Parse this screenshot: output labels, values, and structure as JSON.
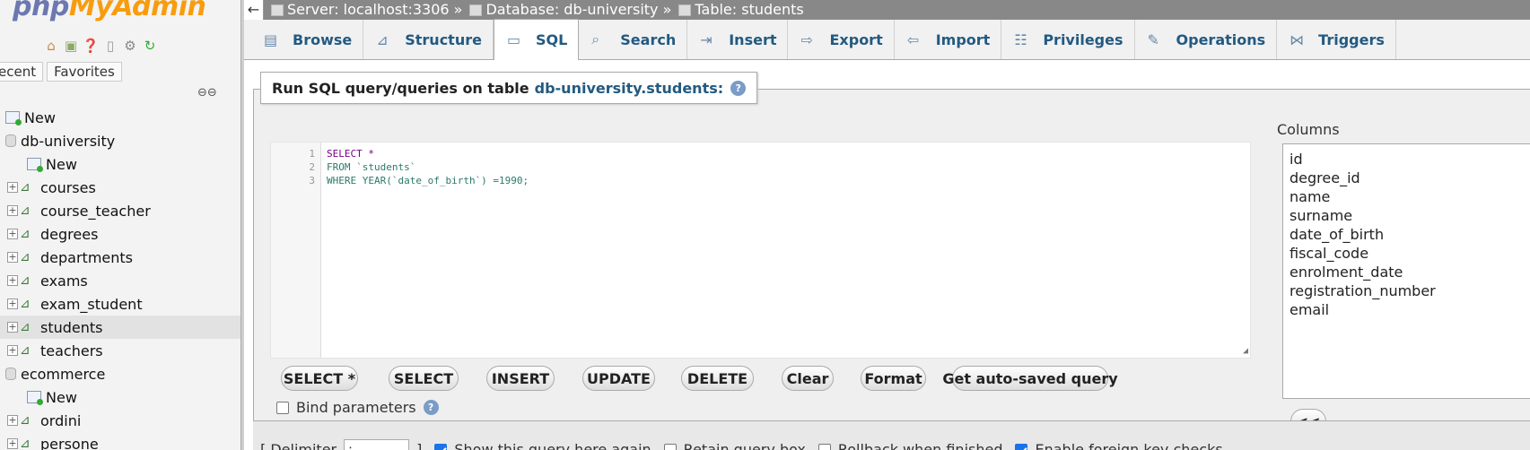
{
  "nav": {
    "logo_php": "php",
    "logo_myadmin": "MyAdmin",
    "tabs": [
      "ecent",
      "Favorites"
    ],
    "tree": [
      {
        "label": "New",
        "icon": "new-icon",
        "level": 0
      },
      {
        "label": "db-university",
        "icon": "database-icon",
        "level": 0
      },
      {
        "label": "New",
        "icon": "new-icon",
        "level": 1
      },
      {
        "label": "courses",
        "icon": "table-icon",
        "level": 1
      },
      {
        "label": "course_teacher",
        "icon": "table-icon",
        "level": 1
      },
      {
        "label": "degrees",
        "icon": "table-icon",
        "level": 1
      },
      {
        "label": "departments",
        "icon": "table-icon",
        "level": 1
      },
      {
        "label": "exams",
        "icon": "table-icon",
        "level": 1
      },
      {
        "label": "exam_student",
        "icon": "table-icon",
        "level": 1
      },
      {
        "label": "students",
        "icon": "table-icon",
        "level": 1,
        "selected": true
      },
      {
        "label": "teachers",
        "icon": "table-icon",
        "level": 1
      },
      {
        "label": "ecommerce",
        "icon": "database-icon",
        "level": 0
      },
      {
        "label": "New",
        "icon": "new-icon",
        "level": 1
      },
      {
        "label": "ordini",
        "icon": "table-icon",
        "level": 1
      },
      {
        "label": "persone",
        "icon": "table-icon",
        "level": 1
      }
    ]
  },
  "breadcrumb": {
    "server": "Server: localhost:3306 »",
    "database": "Database: db-university »",
    "table": "Table: students"
  },
  "tabs": [
    {
      "label": "Browse",
      "icon": "browse-icon"
    },
    {
      "label": "Structure",
      "icon": "structure-icon"
    },
    {
      "label": "SQL",
      "icon": "sql-icon",
      "active": true
    },
    {
      "label": "Search",
      "icon": "search-icon"
    },
    {
      "label": "Insert",
      "icon": "insert-icon"
    },
    {
      "label": "Export",
      "icon": "export-icon"
    },
    {
      "label": "Import",
      "icon": "import-icon"
    },
    {
      "label": "Privileges",
      "icon": "privileges-icon"
    },
    {
      "label": "Operations",
      "icon": "operations-icon"
    },
    {
      "label": "Triggers",
      "icon": "triggers-icon"
    }
  ],
  "sql_panel": {
    "legend_prefix": "Run SQL query/queries on table",
    "legend_table": "db-university.students:",
    "code_lines": [
      {
        "n": "1",
        "text": "SELECT *"
      },
      {
        "n": "2",
        "text": "FROM `students`"
      },
      {
        "n": "3",
        "text": "WHERE YEAR(`date_of_birth`) =1990;"
      }
    ],
    "buttons": [
      "SELECT *",
      "SELECT",
      "INSERT",
      "UPDATE",
      "DELETE",
      "Clear",
      "Format",
      "Get auto-saved query"
    ],
    "bind_parameters": "Bind parameters",
    "columns_label": "Columns",
    "columns": [
      "id",
      "degree_id",
      "name",
      "surname",
      "date_of_birth",
      "fiscal_code",
      "enrolment_date",
      "registration_number",
      "email"
    ],
    "insert_button": "<<"
  },
  "options": {
    "delimiter_label": "[ Delimiter",
    "delimiter_value": ";",
    "delimiter_close": "]",
    "show_query_again": {
      "label": "Show this query here again",
      "checked": true
    },
    "retain_query_box": {
      "label": "Retain query box",
      "checked": false
    },
    "rollback": {
      "label": "Rollback when finished",
      "checked": false
    },
    "foreign_keys": {
      "label": "Enable foreign key checks",
      "checked": true
    }
  }
}
